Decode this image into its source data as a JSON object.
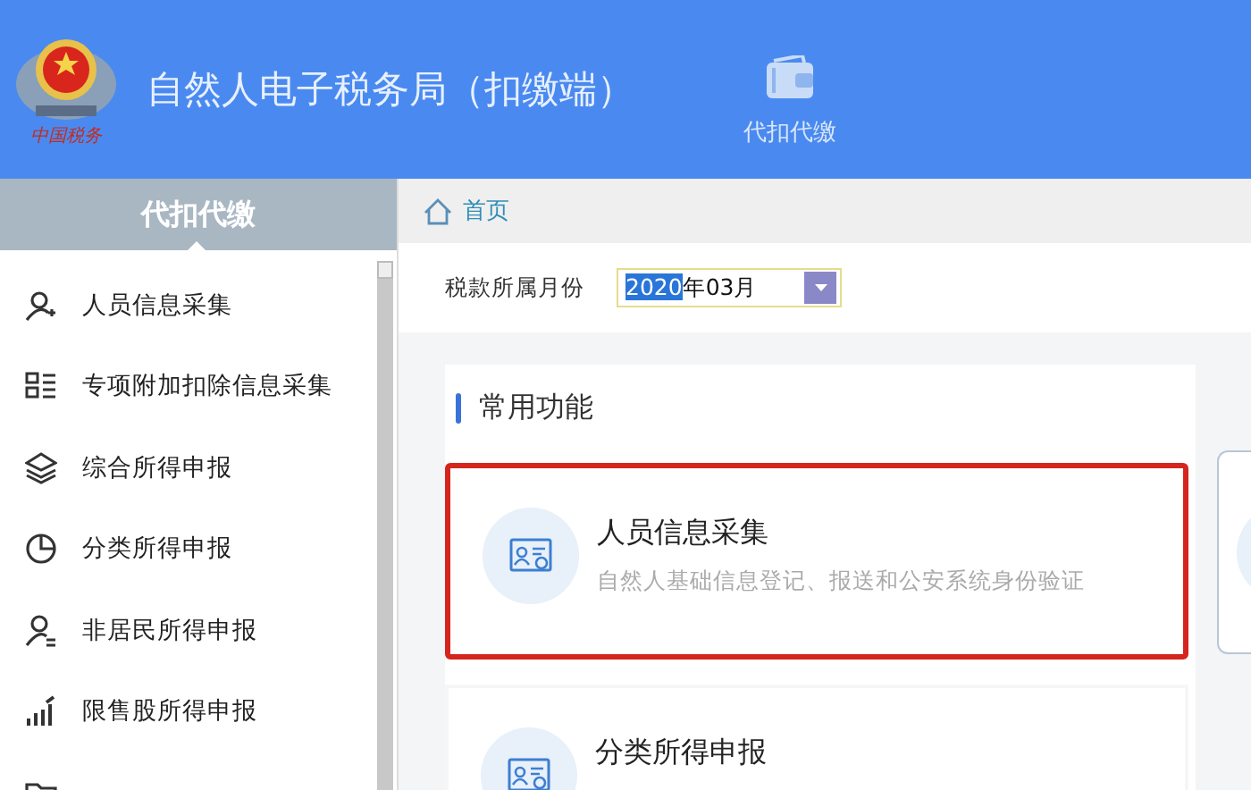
{
  "header": {
    "logo_text": "中国税务",
    "title": "自然人电子税务局（扣缴端）",
    "nav": [
      {
        "label": "代扣代缴",
        "selected": true
      }
    ]
  },
  "sidebar": {
    "title": "代扣代缴",
    "items": [
      {
        "label": "人员信息采集",
        "kind": "person"
      },
      {
        "label": "专项附加扣除信息采集",
        "kind": "list"
      },
      {
        "label": "综合所得申报",
        "kind": "layers"
      },
      {
        "label": "分类所得申报",
        "kind": "pie"
      },
      {
        "label": "非居民所得申报",
        "kind": "person2"
      },
      {
        "label": "限售股所得申报",
        "kind": "bars"
      },
      {
        "kind": "folder"
      }
    ]
  },
  "breadcrumb": {
    "label": "首页"
  },
  "month_field": {
    "label": "税款所属月份",
    "selected_text": "2020",
    "value_rest": "年03月"
  },
  "section": {
    "title": "常用功能",
    "cards": [
      {
        "title": "人员信息采集",
        "description": "自然人基础信息登记、报送和公安系统身份验证",
        "highlighted": true
      },
      {
        "title": "分类所得申报",
        "highlighted": false
      }
    ]
  }
}
